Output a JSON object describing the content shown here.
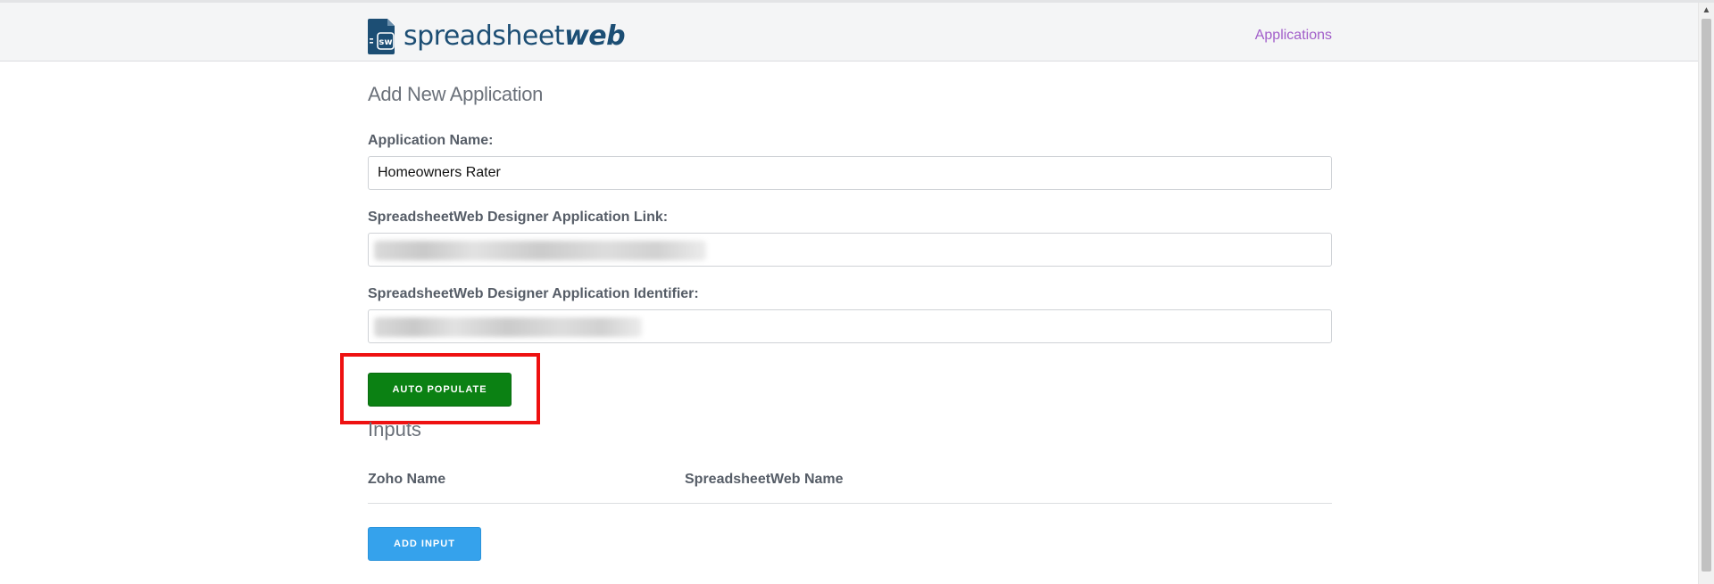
{
  "brand": {
    "logo_badge": "sw",
    "name_light": "spreadsheet",
    "name_bold": "web"
  },
  "nav": {
    "applications_link": "Applications"
  },
  "form": {
    "title": "Add New Application",
    "app_name_label": "Application Name:",
    "app_name_value": "Homeowners Rater",
    "designer_link_label": "SpreadsheetWeb Designer Application Link:",
    "designer_id_label": "SpreadsheetWeb Designer Application Identifier:",
    "auto_populate_label": "AUTO POPULATE"
  },
  "inputs_section": {
    "title": "Inputs",
    "columns": [
      "Zoho Name",
      "SpreadsheetWeb Name"
    ],
    "add_input_label": "ADD INPUT"
  },
  "colors": {
    "brand": "#1c4e74",
    "link": "#a15ec9",
    "populate_button": "#0b8113",
    "add_button": "#35a2ec",
    "highlight": "#ee1111"
  },
  "icons": {
    "logo": "document-sheet-icon",
    "scroll_up": "chevron-up-icon"
  }
}
